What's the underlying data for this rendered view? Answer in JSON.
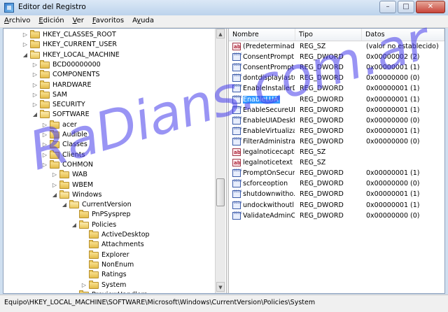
{
  "window": {
    "title": "Editor del Registro",
    "minimize": "–",
    "maximize": "□",
    "close": "✕"
  },
  "menu": [
    {
      "label": "Archivo",
      "key": "A"
    },
    {
      "label": "Edición",
      "key": "E"
    },
    {
      "label": "Ver",
      "key": "V"
    },
    {
      "label": "Favoritos",
      "key": "F"
    },
    {
      "label": "Ayuda",
      "key": "y"
    }
  ],
  "tree": [
    {
      "label": "HKEY_CLASSES_ROOT",
      "level": 0,
      "expanded": false,
      "has_children": true
    },
    {
      "label": "HKEY_CURRENT_USER",
      "level": 0,
      "expanded": false,
      "has_children": true
    },
    {
      "label": "HKEY_LOCAL_MACHINE",
      "level": 0,
      "expanded": true,
      "has_children": true
    },
    {
      "label": "BCD00000000",
      "level": 1,
      "expanded": false,
      "has_children": true
    },
    {
      "label": "COMPONENTS",
      "level": 1,
      "expanded": false,
      "has_children": true
    },
    {
      "label": "HARDWARE",
      "level": 1,
      "expanded": false,
      "has_children": true
    },
    {
      "label": "SAM",
      "level": 1,
      "expanded": false,
      "has_children": true
    },
    {
      "label": "SECURITY",
      "level": 1,
      "expanded": false,
      "has_children": true
    },
    {
      "label": "SOFTWARE",
      "level": 1,
      "expanded": true,
      "has_children": true
    },
    {
      "label": "acer",
      "level": 2,
      "expanded": false,
      "has_children": true
    },
    {
      "label": "Audible",
      "level": 2,
      "expanded": false,
      "has_children": true
    },
    {
      "label": "Classes",
      "level": 2,
      "expanded": false,
      "has_children": true
    },
    {
      "label": "Clients",
      "level": 2,
      "expanded": false,
      "has_children": true
    },
    {
      "label": "COHMON",
      "level": 2,
      "expanded": false,
      "has_children": true
    },
    {
      "label": "WAB",
      "level": 3,
      "expanded": false,
      "has_children": true
    },
    {
      "label": "WBEM",
      "level": 3,
      "expanded": false,
      "has_children": true
    },
    {
      "label": "Windows",
      "level": 3,
      "expanded": true,
      "has_children": true
    },
    {
      "label": "CurrentVersion",
      "level": 4,
      "expanded": true,
      "has_children": true
    },
    {
      "label": "PnPSysprep",
      "level": 5,
      "expanded": false,
      "has_children": false
    },
    {
      "label": "Policies",
      "level": 5,
      "expanded": true,
      "has_children": true
    },
    {
      "label": "ActiveDesktop",
      "level": 6,
      "expanded": false,
      "has_children": false
    },
    {
      "label": "Attachments",
      "level": 6,
      "expanded": false,
      "has_children": false
    },
    {
      "label": "Explorer",
      "level": 6,
      "expanded": false,
      "has_children": false
    },
    {
      "label": "NonEnum",
      "level": 6,
      "expanded": false,
      "has_children": false
    },
    {
      "label": "Ratings",
      "level": 6,
      "expanded": false,
      "has_children": false
    },
    {
      "label": "System",
      "level": 6,
      "expanded": false,
      "has_children": true
    },
    {
      "label": "PreviewHandlers",
      "level": 5,
      "expanded": false,
      "has_children": true
    }
  ],
  "columns": [
    "Nombre",
    "Tipo",
    "Datos"
  ],
  "values": [
    {
      "icon": "string-value-icon",
      "name": "(Predeterminado)",
      "type": "REG_SZ",
      "data": "(valor no establecido)"
    },
    {
      "icon": "binary-value-icon",
      "name": "ConsentPrompt...",
      "type": "REG_DWORD",
      "data": "0x00000002 (2)"
    },
    {
      "icon": "binary-value-icon",
      "name": "ConsentPrompt...",
      "type": "REG_DWORD",
      "data": "0x00000001 (1)"
    },
    {
      "icon": "binary-value-icon",
      "name": "dontdisplaylastu...",
      "type": "REG_DWORD",
      "data": "0x00000000 (0)"
    },
    {
      "icon": "binary-value-icon",
      "name": "EnableInstallerD...",
      "type": "REG_DWORD",
      "data": "0x00000001 (1)"
    },
    {
      "icon": "binary-value-icon",
      "name": "EnableLUA",
      "type": "REG_DWORD",
      "data": "0x00000001 (1)",
      "selected": true
    },
    {
      "icon": "binary-value-icon",
      "name": "EnableSecureUI...",
      "type": "REG_DWORD",
      "data": "0x00000001 (1)"
    },
    {
      "icon": "binary-value-icon",
      "name": "EnableUIADeskt...",
      "type": "REG_DWORD",
      "data": "0x00000000 (0)"
    },
    {
      "icon": "binary-value-icon",
      "name": "EnableVirtualizat...",
      "type": "REG_DWORD",
      "data": "0x00000001 (1)"
    },
    {
      "icon": "binary-value-icon",
      "name": "FilterAdministra...",
      "type": "REG_DWORD",
      "data": "0x00000000 (0)"
    },
    {
      "icon": "string-value-icon",
      "name": "legalnoticecapti...",
      "type": "REG_SZ",
      "data": ""
    },
    {
      "icon": "string-value-icon",
      "name": "legalnoticetext",
      "type": "REG_SZ",
      "data": ""
    },
    {
      "icon": "binary-value-icon",
      "name": "PromptOnSecur...",
      "type": "REG_DWORD",
      "data": "0x00000001 (1)"
    },
    {
      "icon": "binary-value-icon",
      "name": "scforceoption",
      "type": "REG_DWORD",
      "data": "0x00000000 (0)"
    },
    {
      "icon": "binary-value-icon",
      "name": "shutdownwitho...",
      "type": "REG_DWORD",
      "data": "0x00000001 (1)"
    },
    {
      "icon": "binary-value-icon",
      "name": "undockwithoutl...",
      "type": "REG_DWORD",
      "data": "0x00000001 (1)"
    },
    {
      "icon": "binary-value-icon",
      "name": "ValidateAdminC...",
      "type": "REG_DWORD",
      "data": "0x00000000 (0)"
    }
  ],
  "statusbar": {
    "path": "Equipo\\HKEY_LOCAL_MACHINE\\SOFTWARE\\Microsoft\\Windows\\CurrentVersion\\Policies\\System"
  },
  "watermark": "RaDians.com.ar",
  "colors": {
    "selection": "#3399ff",
    "watermark": "#4a3ceb"
  }
}
